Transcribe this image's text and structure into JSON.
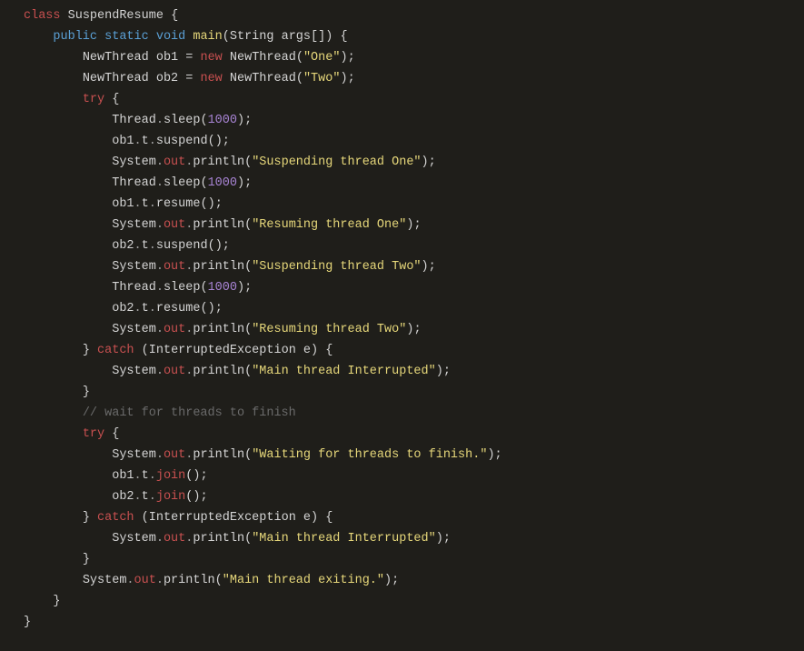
{
  "keywords": {
    "class": "class",
    "public": "public",
    "static": "static",
    "void": "void",
    "new": "new",
    "try": "try",
    "catch": "catch"
  },
  "identifiers": {
    "className": "SuspendResume",
    "main": "main",
    "stringType": "String",
    "args": "args",
    "newThread": "NewThread",
    "ob1": "ob1",
    "ob2": "ob2",
    "thread": "Thread",
    "sleep": "sleep",
    "t": "t",
    "suspend": "suspend",
    "resume": "resume",
    "system": "System",
    "out": "out",
    "println": "println",
    "interruptedException": "InterruptedException",
    "e": "e",
    "join": "join"
  },
  "strings": {
    "one": "\"One\"",
    "two": "\"Two\"",
    "suspendOne": "\"Suspending thread One\"",
    "resumeOne": "\"Resuming thread One\"",
    "suspendTwo": "\"Suspending thread Two\"",
    "resumeTwo": "\"Resuming thread Two\"",
    "mainInterrupted": "\"Main thread Interrupted\"",
    "waiting": "\"Waiting for threads to finish.\"",
    "exiting": "\"Main thread exiting.\""
  },
  "numbers": {
    "n1000": "1000"
  },
  "comments": {
    "waitFinish": "// wait for threads to finish"
  },
  "punct": {
    "openBrace": "{",
    "closeBrace": "}",
    "openParen": "(",
    "closeParen": ")",
    "openBracket": "[",
    "closeBracket": "]",
    "semicolon": ";",
    "dot": ".",
    "equals": "=",
    "space": " "
  }
}
